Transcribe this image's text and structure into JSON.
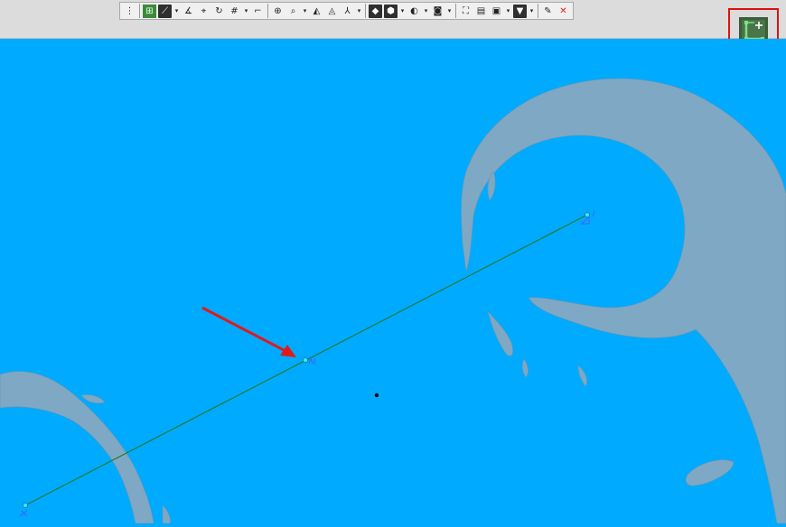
{
  "toolbar": {
    "buttons": [
      {
        "icon": "grip-icon",
        "glyph": "⋮"
      },
      {
        "icon": "sketch-grid-icon",
        "glyph": "⊞",
        "style": "green"
      },
      {
        "icon": "dimension-icon",
        "glyph": "⟋",
        "style": "dark"
      },
      {
        "icon": "dropdown-icon",
        "glyph": "▾",
        "drop": true
      },
      {
        "icon": "angle-dimension-icon",
        "glyph": "∡"
      },
      {
        "icon": "smart-dimension-icon",
        "glyph": "⌖"
      },
      {
        "icon": "rotate-view-icon",
        "glyph": "↻"
      },
      {
        "icon": "grid-icon",
        "glyph": "#"
      },
      {
        "icon": "dropdown-icon",
        "glyph": "▾",
        "drop": true
      },
      {
        "icon": "line-tool-icon",
        "glyph": "⌐"
      },
      {
        "icon": "zoom-area-icon",
        "glyph": "⊕"
      },
      {
        "icon": "zoom-fit-icon",
        "glyph": "⌕"
      },
      {
        "icon": "dropdown-icon",
        "glyph": "▾",
        "drop": true
      },
      {
        "icon": "appearance-icon",
        "glyph": "◭"
      },
      {
        "icon": "section-icon",
        "glyph": "◬"
      },
      {
        "icon": "axis-triad-icon",
        "glyph": "⅄"
      },
      {
        "icon": "dropdown-icon",
        "glyph": "▾",
        "drop": true
      },
      {
        "icon": "view-orientation-icon",
        "glyph": "◆",
        "style": "dark"
      },
      {
        "icon": "display-style-icon",
        "glyph": "⬢",
        "style": "dark"
      },
      {
        "icon": "dropdown-icon",
        "glyph": "▾",
        "drop": true
      },
      {
        "icon": "hide-show-icon",
        "glyph": "◐"
      },
      {
        "icon": "dropdown-icon",
        "glyph": "▾",
        "drop": true
      },
      {
        "icon": "edit-appearance-icon",
        "glyph": "◙"
      },
      {
        "icon": "dropdown-icon",
        "glyph": "▾",
        "drop": true
      },
      {
        "icon": "scene-icon",
        "glyph": "⛶"
      },
      {
        "icon": "view-settings-icon",
        "glyph": "▤"
      },
      {
        "icon": "render-tools-icon",
        "glyph": "▣"
      },
      {
        "icon": "dropdown-icon",
        "glyph": "▾",
        "drop": true
      },
      {
        "icon": "filter-icon",
        "glyph": "▼",
        "style": "dark"
      },
      {
        "icon": "dropdown-icon",
        "glyph": "▾",
        "drop": true
      },
      {
        "icon": "eyedropper-icon",
        "glyph": "✎"
      },
      {
        "icon": "close-icon",
        "glyph": "✕",
        "color": "#e02020"
      }
    ]
  },
  "corner_button": {
    "icon": "add-sketch-corner-icon"
  },
  "viewport": {
    "background": "#00aaff",
    "surface_color": "#7fa8c4",
    "line_color": "#1f7a2a",
    "point_color": "#40e0ff",
    "arrow_color": "#e01a1a"
  }
}
